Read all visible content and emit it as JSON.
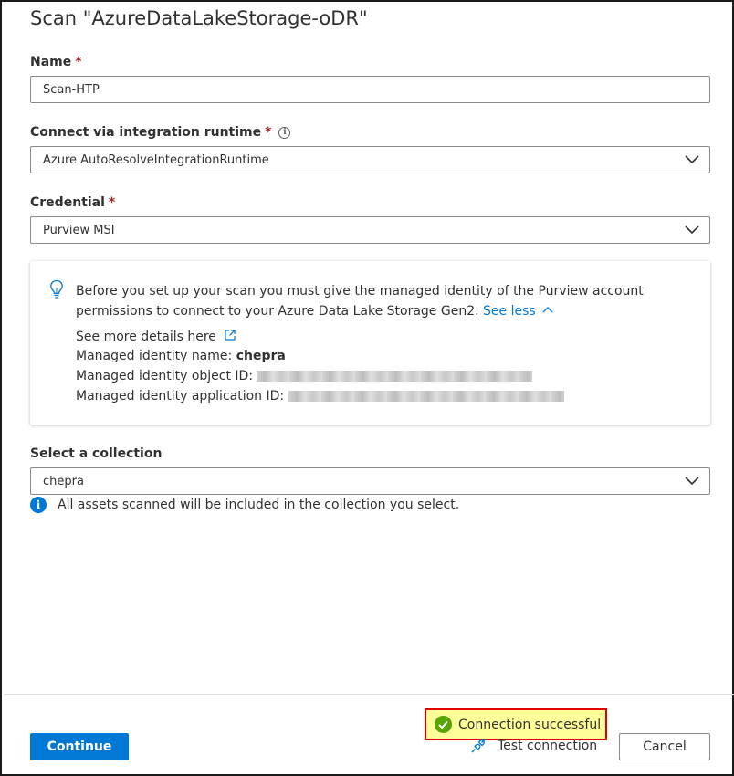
{
  "dialog": {
    "title": "Scan \"AzureDataLakeStorage-oDR\""
  },
  "name_field": {
    "label": "Name",
    "required_mark": "*",
    "value": "Scan-HTP"
  },
  "runtime_field": {
    "label": "Connect via integration runtime",
    "required_mark": "*",
    "info_glyph": "i",
    "value": "Azure AutoResolveIntegrationRuntime"
  },
  "credential_field": {
    "label": "Credential",
    "required_mark": "*",
    "value": "Purview MSI"
  },
  "info_card": {
    "icon": "lightbulb-icon",
    "message": "Before you set up your scan you must give the managed identity of the Purview account permissions to connect to your Azure Data Lake Storage Gen2.",
    "see_less": "See less",
    "details_link": "See more details here",
    "identity_name_label": "Managed identity name:",
    "identity_name_value": "chepra",
    "object_id_label": "Managed identity object ID:",
    "application_id_label": "Managed identity application ID:"
  },
  "collection_field": {
    "label": "Select a collection",
    "value": "chepra",
    "hint_glyph": "i",
    "hint": "All assets scanned will be included in the collection you select."
  },
  "footer": {
    "continue_label": "Continue",
    "test_connection_label": "Test connection",
    "cancel_label": "Cancel",
    "status_text": "Connection successful"
  },
  "colors": {
    "accent": "#0078d4",
    "required": "#a4262c",
    "success": "#57a300",
    "highlight": "#ffff99",
    "highlight_border": "#e00000"
  }
}
